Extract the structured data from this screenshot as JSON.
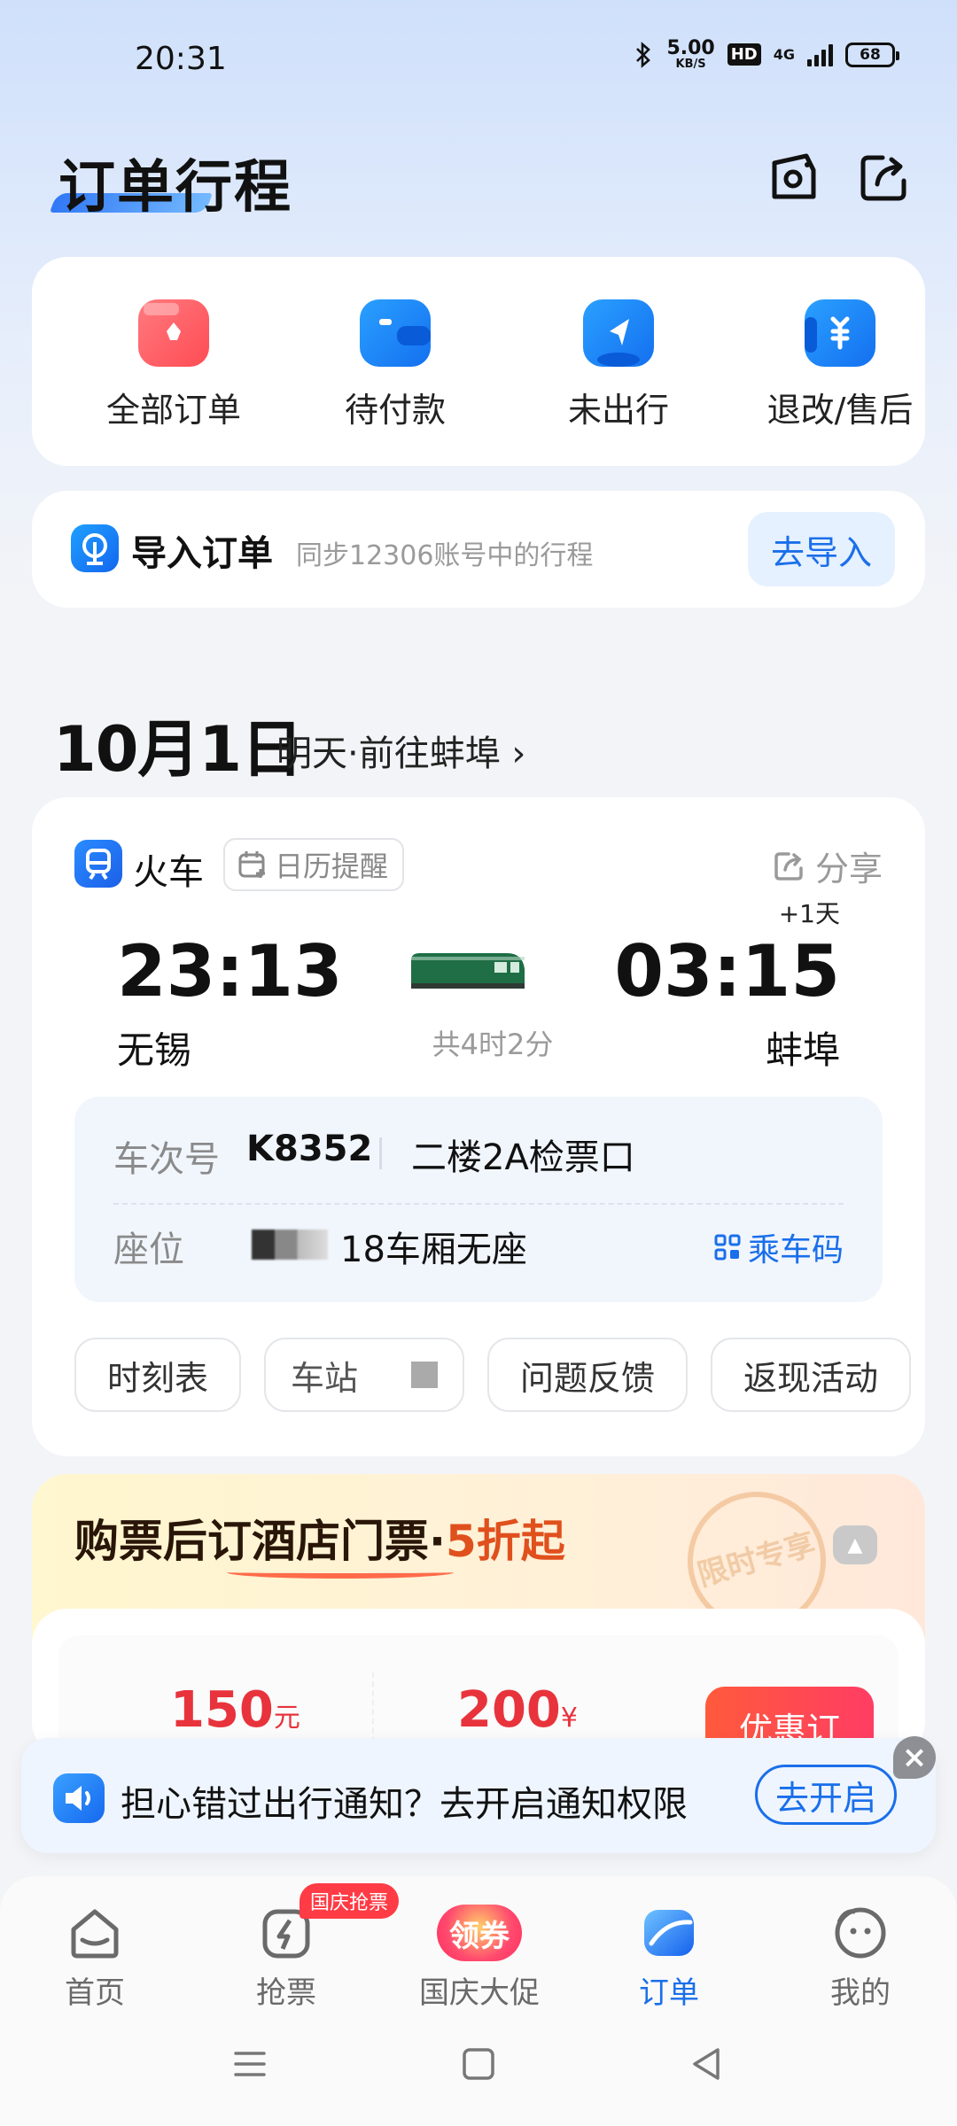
{
  "status": {
    "time": "20:31",
    "speed_value": "5.00",
    "speed_unit": "KB/S",
    "hd": "HD",
    "network": "4G",
    "battery": "68"
  },
  "header": {
    "title": "订单行程"
  },
  "quick_actions": [
    {
      "label": "全部订单",
      "icon": "all-orders-icon",
      "color": "#ff5b60"
    },
    {
      "label": "待付款",
      "icon": "wallet-icon",
      "color": "#1b8cff"
    },
    {
      "label": "未出行",
      "icon": "send-icon",
      "color": "#1b8cff"
    },
    {
      "label": "退改/售后",
      "icon": "refund-icon",
      "color": "#1b8cff"
    }
  ],
  "import": {
    "title": "导入订单",
    "desc": "同步12306账号中的行程",
    "button": "去导入"
  },
  "trip_date": {
    "date": "10月1日",
    "subtitle": "明天·前往蚌埠 ›"
  },
  "trip": {
    "type_label": "火车",
    "calendar_label": "日历提醒",
    "share_label": "分享",
    "next_day": "+1天",
    "depart_time": "23:13",
    "depart_station": "无锡",
    "arrive_time": "03:15",
    "arrive_station": "蚌埠",
    "duration": "共4时2分",
    "train_no_label": "车次号",
    "train_no": "K8352",
    "gate": "二楼2A检票口",
    "seat_label": "座位",
    "seat": "18车厢无座",
    "ride_code": "乘车码",
    "chips": [
      "时刻表",
      "车站",
      "问题反馈",
      "返现活动"
    ]
  },
  "promo": {
    "title_a": "购票后",
    "title_b": "订酒店门票",
    "title_c": "·",
    "title_d": "5折起",
    "stamp": "限时专享",
    "coupon1_value": "150",
    "coupon1_unit": "元",
    "coupon2_value": "200",
    "coupon2_unit": "¥",
    "button": "优惠订"
  },
  "notice": {
    "text": "担心错过出行通知？去开启通知权限",
    "button": "去开启",
    "close": "×"
  },
  "tabs": [
    {
      "label": "首页",
      "icon": "home-icon"
    },
    {
      "label": "抢票",
      "icon": "grab-ticket-icon"
    },
    {
      "label": "国庆大促",
      "icon": "coupon-icon"
    },
    {
      "label": "订单",
      "icon": "orders-icon"
    },
    {
      "label": "我的",
      "icon": "profile-icon"
    }
  ],
  "tab_badge": "国庆抢票",
  "coupon_tab_text": "领券",
  "colors": {
    "accent": "#1a6fea",
    "danger": "#e8333c"
  }
}
